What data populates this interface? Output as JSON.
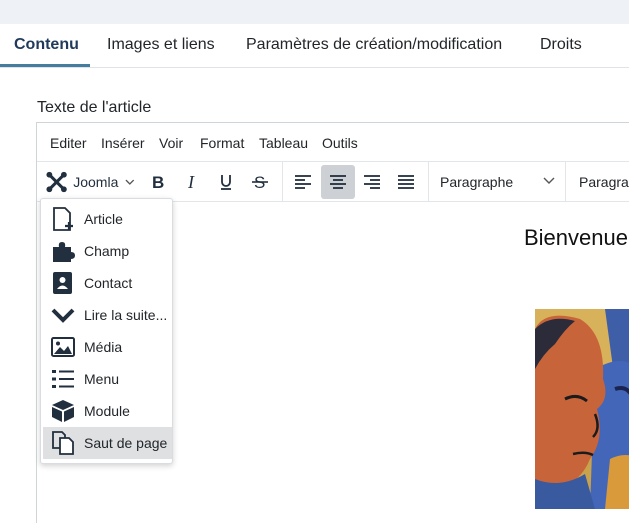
{
  "tabs": [
    {
      "label": "Contenu",
      "active": true
    },
    {
      "label": "Images et liens",
      "active": false
    },
    {
      "label": "Paramètres de création/modification",
      "active": false
    },
    {
      "label": "Droits",
      "active": false
    }
  ],
  "field_label": "Texte de l'article",
  "menubar": [
    "Editer",
    "Insérer",
    "Voir",
    "Format",
    "Tableau",
    "Outils"
  ],
  "toolbar": {
    "joomla_label": "Joomla",
    "block_format": "Paragraphe",
    "font_format": "Paragraphe"
  },
  "dropdown": [
    {
      "label": "Article",
      "icon": "file-plus-icon"
    },
    {
      "label": "Champ",
      "icon": "puzzle-icon"
    },
    {
      "label": "Contact",
      "icon": "address-book-icon"
    },
    {
      "label": "Lire la suite...",
      "icon": "chevron-down-icon"
    },
    {
      "label": "Média",
      "icon": "image-icon"
    },
    {
      "label": "Menu",
      "icon": "list-icon"
    },
    {
      "label": "Module",
      "icon": "cube-icon"
    },
    {
      "label": "Saut de page",
      "icon": "copy-icon",
      "highlighted": true
    }
  ],
  "content": {
    "title": "Bienvenue"
  },
  "colors": {
    "accent": "#457d9f",
    "active_tab_text": "#1f3a5a",
    "highlight": "#dee0e2"
  }
}
